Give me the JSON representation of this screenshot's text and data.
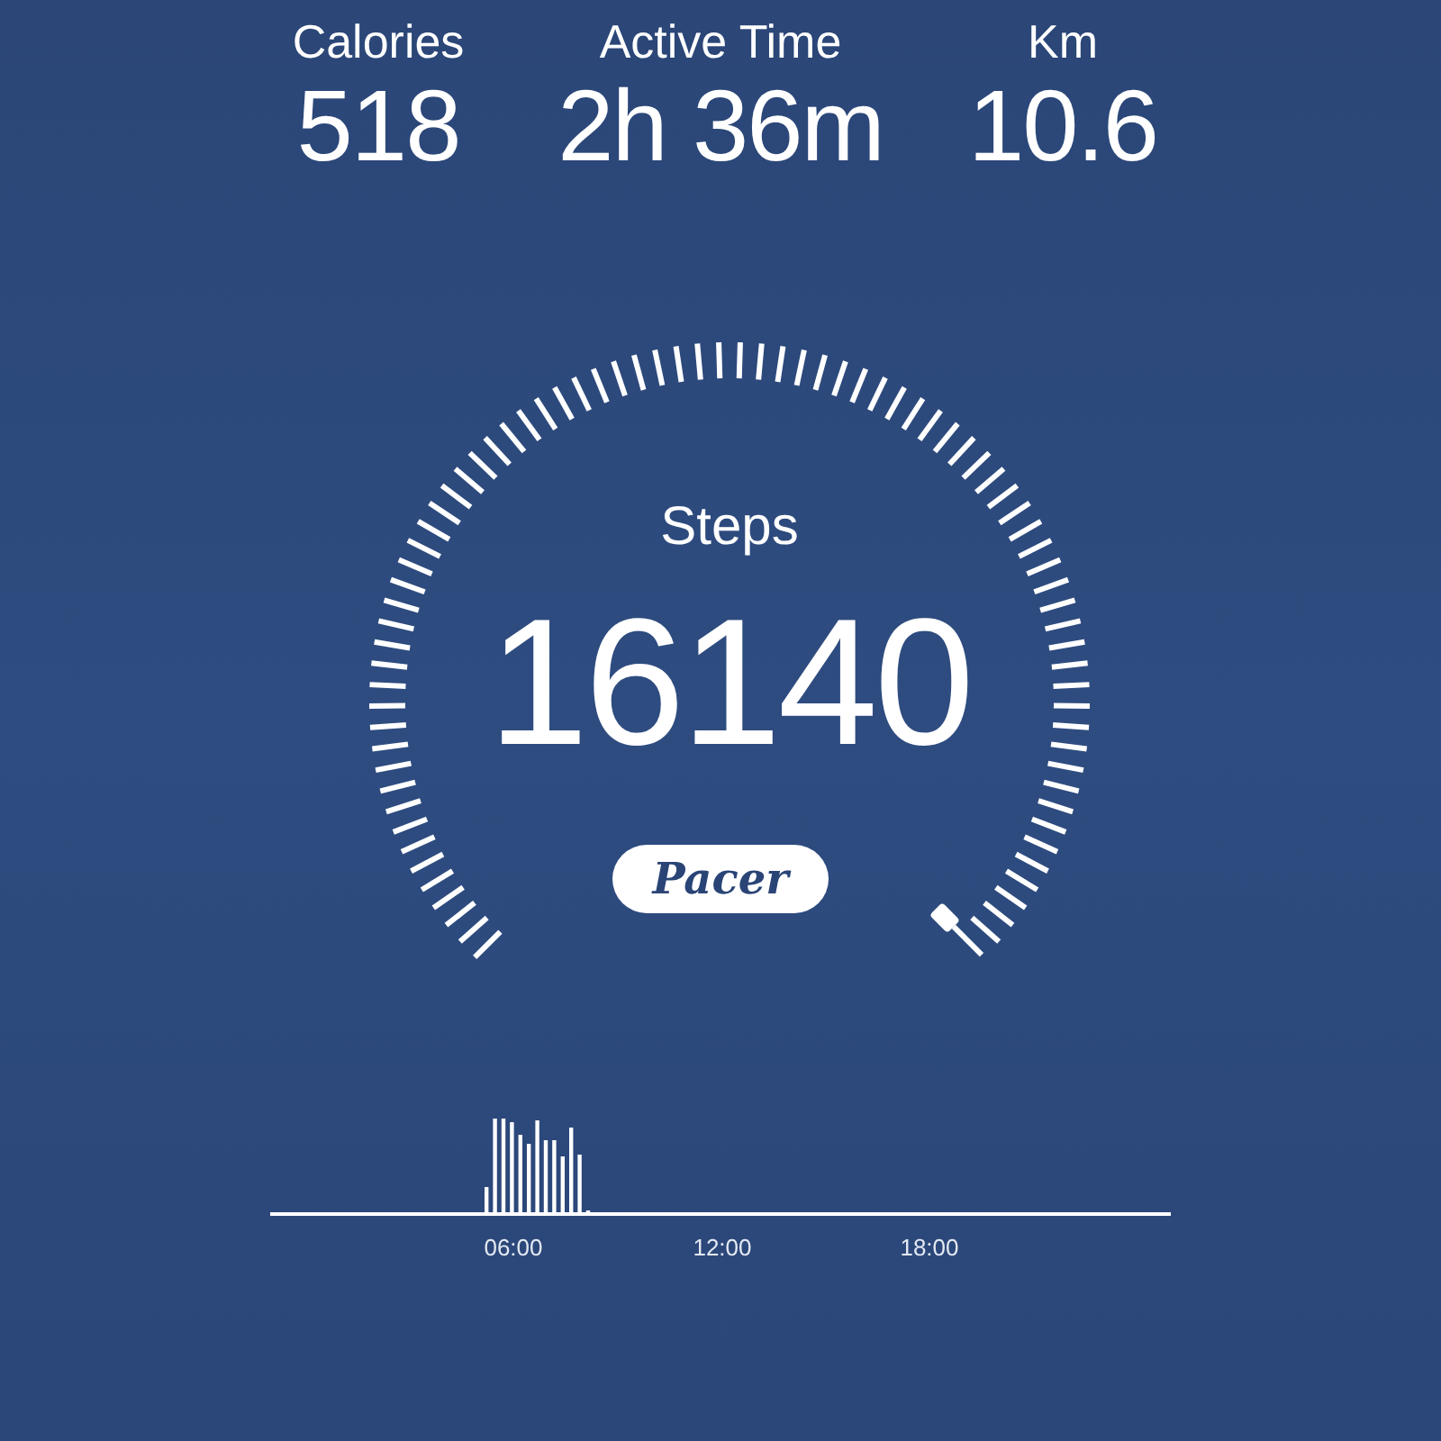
{
  "stats": [
    {
      "label": "Calories",
      "value": "518"
    },
    {
      "label": "Active Time",
      "value": "2h 36m"
    },
    {
      "label": "Km",
      "value": "10.6"
    }
  ],
  "gauge": {
    "label": "Steps",
    "value": "16140"
  },
  "logo": {
    "text": "Pacer"
  },
  "activity_chart": {
    "x_labels": [
      "06:00",
      "12:00",
      "18:00"
    ]
  }
}
